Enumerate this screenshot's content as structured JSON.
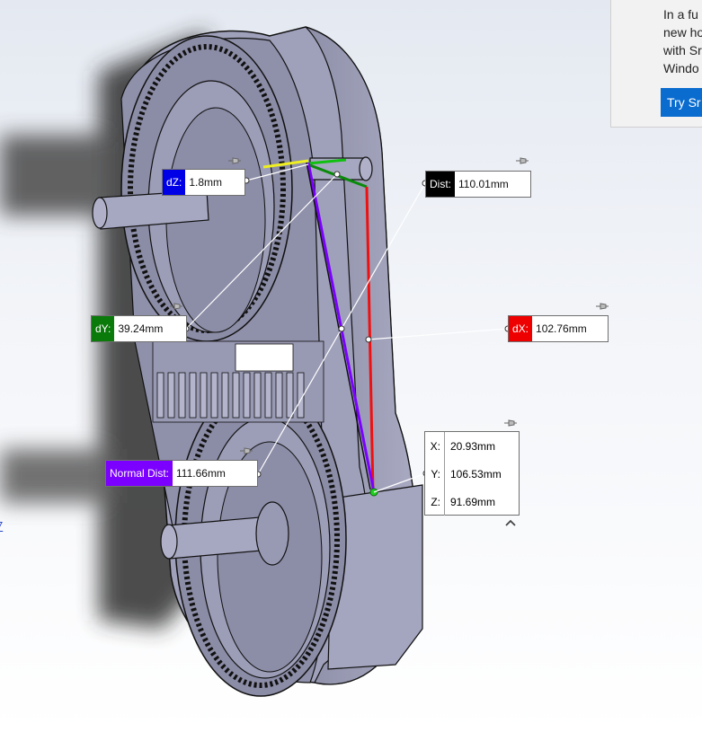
{
  "notification": {
    "text_lines": [
      "In a fu",
      "new ho",
      "with Sr",
      "Windo"
    ],
    "button_label": "Try Sr"
  },
  "side_link": "7",
  "measurements": {
    "dz": {
      "label": "dZ:",
      "value": "1.8mm",
      "color": "#0000e6"
    },
    "dy": {
      "label": "dY:",
      "value": "39.24mm",
      "color": "#0a7a0a"
    },
    "normal_dist": {
      "label": "Normal Dist:",
      "value": "111.66mm",
      "color": "#7b00ff"
    },
    "dist": {
      "label": "Dist:",
      "value": "110.01mm",
      "color": "#000000"
    },
    "dx": {
      "label": "dX:",
      "value": "102.76mm",
      "color": "#ee0000"
    }
  },
  "coordinates": {
    "x_label": "X:",
    "x_value": "20.93mm",
    "y_label": "Y:",
    "y_value": "106.53mm",
    "z_label": "Z:",
    "z_value": "91.69mm"
  },
  "icons": [
    "pin-icon",
    "chevron-up-icon",
    "point-marker-icon"
  ]
}
